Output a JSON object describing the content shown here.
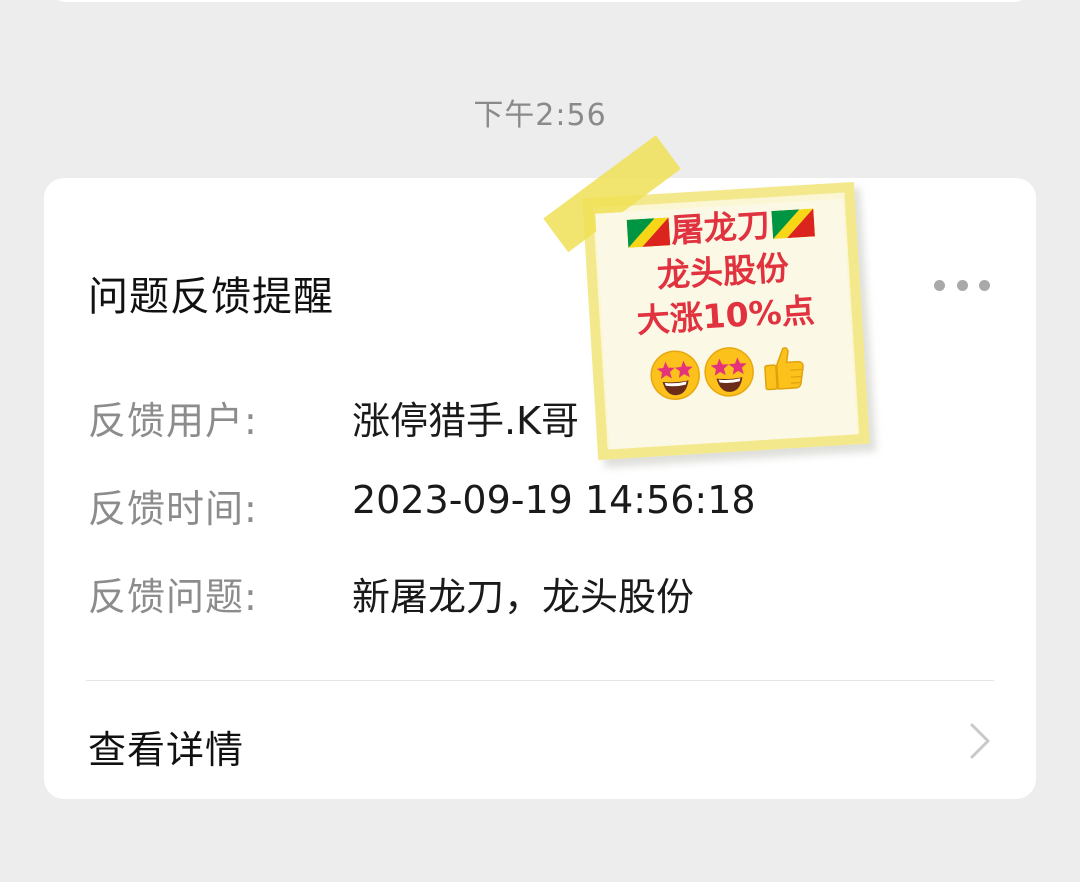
{
  "chat": {
    "timestamp": "下午2:56"
  },
  "card": {
    "title": "问题反馈提醒",
    "fields": [
      {
        "label": "反馈用户:",
        "value": "涨停猎手.K哥"
      },
      {
        "label": "反馈时间:",
        "value": "2023-09-19 14:56:18"
      },
      {
        "label": "反馈问题:",
        "value": "新屠龙刀，龙头股份"
      }
    ],
    "detail_label": "查看详情",
    "more_icon": "more-dots-icon",
    "chevron_icon": "chevron-right-icon"
  },
  "sticky_note": {
    "line1": "屠龙刀",
    "line2": "龙头股份",
    "line3": "大涨10%点",
    "flag_icon": "congo-flag-icon",
    "emojis": [
      "star-struck-icon",
      "star-struck-icon",
      "thumbs-up-icon"
    ],
    "text_color": "#e0323f"
  },
  "colors": {
    "background": "#ededed",
    "card": "#ffffff",
    "note_paper": "#fbf6d3",
    "tape": "#f0e056"
  }
}
